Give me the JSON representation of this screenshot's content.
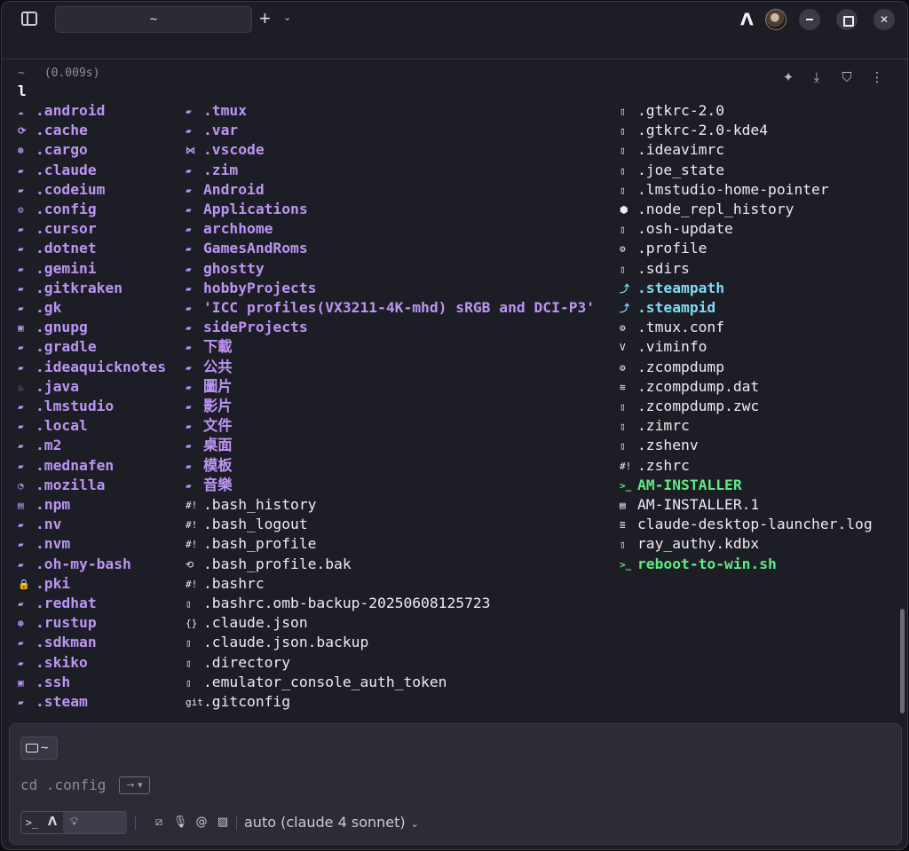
{
  "titlebar": {
    "tab_title": "~",
    "new_tab_label": "+",
    "tab_menu_icon": "chevron-down-icon"
  },
  "block": {
    "cwd": "~",
    "duration": "(0.009s)",
    "command": "l"
  },
  "listing": {
    "columns": [
      [
        {
          "name": ".android",
          "type": "dir",
          "icon": "☁"
        },
        {
          "name": ".cache",
          "type": "dir",
          "icon": "⟳"
        },
        {
          "name": ".cargo",
          "type": "dir",
          "icon": "⊛"
        },
        {
          "name": ".claude",
          "type": "dir",
          "icon": "▰"
        },
        {
          "name": ".codeium",
          "type": "dir",
          "icon": "▰"
        },
        {
          "name": ".config",
          "type": "dir",
          "icon": "⚙"
        },
        {
          "name": ".cursor",
          "type": "dir",
          "icon": "▰"
        },
        {
          "name": ".dotnet",
          "type": "dir",
          "icon": "▰"
        },
        {
          "name": ".gemini",
          "type": "dir",
          "icon": "▰"
        },
        {
          "name": ".gitkraken",
          "type": "dir",
          "icon": "▰"
        },
        {
          "name": ".gk",
          "type": "dir",
          "icon": "▰"
        },
        {
          "name": ".gnupg",
          "type": "dir",
          "icon": "▣"
        },
        {
          "name": ".gradle",
          "type": "dir",
          "icon": "▰"
        },
        {
          "name": ".ideaquicknotes",
          "type": "dir",
          "icon": "▰"
        },
        {
          "name": ".java",
          "type": "dir",
          "icon": "♨"
        },
        {
          "name": ".lmstudio",
          "type": "dir",
          "icon": "▰"
        },
        {
          "name": ".local",
          "type": "dir",
          "icon": "▰"
        },
        {
          "name": ".m2",
          "type": "dir",
          "icon": "▰"
        },
        {
          "name": ".mednafen",
          "type": "dir",
          "icon": "▰"
        },
        {
          "name": ".mozilla",
          "type": "dir",
          "icon": "◔"
        },
        {
          "name": ".npm",
          "type": "dir",
          "icon": "▤"
        },
        {
          "name": ".nv",
          "type": "dir",
          "icon": "▰"
        },
        {
          "name": ".nvm",
          "type": "dir",
          "icon": "▰"
        },
        {
          "name": ".oh-my-bash",
          "type": "dir",
          "icon": "▰"
        },
        {
          "name": ".pki",
          "type": "dir",
          "icon": "🔒"
        },
        {
          "name": ".redhat",
          "type": "dir",
          "icon": "▰"
        },
        {
          "name": ".rustup",
          "type": "dir",
          "icon": "⊛"
        },
        {
          "name": ".sdkman",
          "type": "dir",
          "icon": "▰"
        },
        {
          "name": ".skiko",
          "type": "dir",
          "icon": "▰"
        },
        {
          "name": ".ssh",
          "type": "dir",
          "icon": "▣"
        },
        {
          "name": ".steam",
          "type": "dir",
          "icon": "▰"
        }
      ],
      [
        {
          "name": ".tmux",
          "type": "dir",
          "icon": "▰"
        },
        {
          "name": ".var",
          "type": "dir",
          "icon": "▰"
        },
        {
          "name": ".vscode",
          "type": "dir",
          "icon": "⋈"
        },
        {
          "name": ".zim",
          "type": "dir",
          "icon": "▰"
        },
        {
          "name": "Android",
          "type": "dir",
          "icon": "▰"
        },
        {
          "name": "Applications",
          "type": "dir",
          "icon": "▰"
        },
        {
          "name": "archhome",
          "type": "dir",
          "icon": "▰"
        },
        {
          "name": "GamesAndRoms",
          "type": "dir",
          "icon": "▰"
        },
        {
          "name": "ghostty",
          "type": "dir",
          "icon": "▰"
        },
        {
          "name": "hobbyProjects",
          "type": "dir",
          "icon": "▰"
        },
        {
          "name": "'ICC profiles(VX3211-4K-mhd) sRGB and DCI-P3'",
          "type": "dir",
          "icon": "▰"
        },
        {
          "name": "sideProjects",
          "type": "dir",
          "icon": "▰"
        },
        {
          "name": "下載",
          "type": "dir",
          "icon": "▰"
        },
        {
          "name": "公共",
          "type": "dir",
          "icon": "▰"
        },
        {
          "name": "圖片",
          "type": "dir",
          "icon": "▰"
        },
        {
          "name": "影片",
          "type": "dir",
          "icon": "▰"
        },
        {
          "name": "文件",
          "type": "dir",
          "icon": "▰"
        },
        {
          "name": "桌面",
          "type": "dir",
          "icon": "▰"
        },
        {
          "name": "模板",
          "type": "dir",
          "icon": "▰"
        },
        {
          "name": "音樂",
          "type": "dir",
          "icon": "▰"
        },
        {
          "name": ".bash_history",
          "type": "file",
          "icon": "#!"
        },
        {
          "name": ".bash_logout",
          "type": "file",
          "icon": "#!"
        },
        {
          "name": ".bash_profile",
          "type": "file",
          "icon": "#!"
        },
        {
          "name": ".bash_profile.bak",
          "type": "file",
          "icon": "⟲"
        },
        {
          "name": ".bashrc",
          "type": "file",
          "icon": "#!"
        },
        {
          "name": ".bashrc.omb-backup-20250608125723",
          "type": "file",
          "icon": "▯"
        },
        {
          "name": ".claude.json",
          "type": "file",
          "icon": "{}"
        },
        {
          "name": ".claude.json.backup",
          "type": "file",
          "icon": "▯"
        },
        {
          "name": ".directory",
          "type": "file",
          "icon": "▯"
        },
        {
          "name": ".emulator_console_auth_token",
          "type": "file",
          "icon": "▯"
        },
        {
          "name": ".gitconfig",
          "type": "file",
          "icon": "git"
        }
      ],
      [
        {
          "name": ".gtkrc-2.0",
          "type": "file",
          "icon": "▯"
        },
        {
          "name": ".gtkrc-2.0-kde4",
          "type": "file",
          "icon": "▯"
        },
        {
          "name": ".ideavimrc",
          "type": "file",
          "icon": "▯"
        },
        {
          "name": ".joe_state",
          "type": "file",
          "icon": "▯"
        },
        {
          "name": ".lmstudio-home-pointer",
          "type": "file",
          "icon": "▯"
        },
        {
          "name": ".node_repl_history",
          "type": "file",
          "icon": "⬢"
        },
        {
          "name": ".osh-update",
          "type": "file",
          "icon": "▯"
        },
        {
          "name": ".profile",
          "type": "file",
          "icon": "⚙"
        },
        {
          "name": ".sdirs",
          "type": "file",
          "icon": "▯"
        },
        {
          "name": ".steampath",
          "type": "link",
          "icon": "⤴"
        },
        {
          "name": ".steampid",
          "type": "link",
          "icon": "⤴"
        },
        {
          "name": ".tmux.conf",
          "type": "file",
          "icon": "⚙"
        },
        {
          "name": ".viminfo",
          "type": "file",
          "icon": "V"
        },
        {
          "name": ".zcompdump",
          "type": "file",
          "icon": "⚙"
        },
        {
          "name": ".zcompdump.dat",
          "type": "file",
          "icon": "≋"
        },
        {
          "name": ".zcompdump.zwc",
          "type": "file",
          "icon": "▯"
        },
        {
          "name": ".zimrc",
          "type": "file",
          "icon": "▯"
        },
        {
          "name": ".zshenv",
          "type": "file",
          "icon": "▯"
        },
        {
          "name": ".zshrc",
          "type": "file",
          "icon": "#!"
        },
        {
          "name": "AM-INSTALLER",
          "type": "exec",
          "icon": ">_"
        },
        {
          "name": "AM-INSTALLER.1",
          "type": "file",
          "icon": "▤"
        },
        {
          "name": "claude-desktop-launcher.log",
          "type": "file",
          "icon": "≣"
        },
        {
          "name": "ray_authy.kdbx",
          "type": "file",
          "icon": "▯"
        },
        {
          "name": "reboot-to-win.sh",
          "type": "exec",
          "icon": ">_"
        }
      ]
    ]
  },
  "input": {
    "cwd_chip": "~",
    "placeholder": "cd .config",
    "accept_hint": "→ ▾",
    "mode_terminal": ">_",
    "mode_agent": "A",
    "mode_auto_icon": "lightbulb-icon",
    "model": "auto (claude 4 sonnet)"
  }
}
